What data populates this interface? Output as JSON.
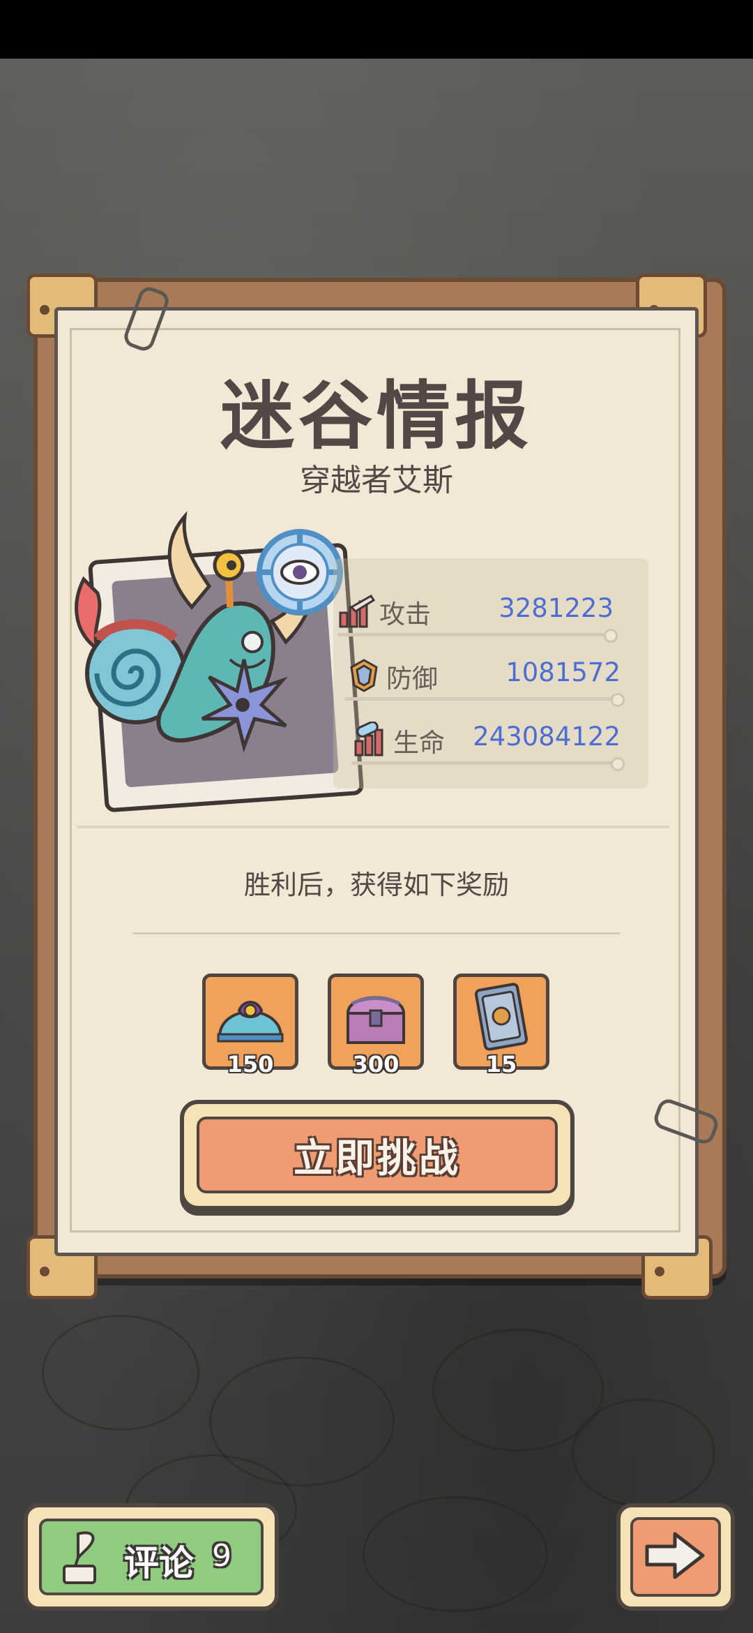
{
  "panel": {
    "title": "迷谷情报",
    "subtitle": "穿越者艾斯"
  },
  "stats": [
    {
      "icon": "attack-icon",
      "label": "攻击",
      "value": "3281223"
    },
    {
      "icon": "defense-icon",
      "label": "防御",
      "value": "1081572"
    },
    {
      "icon": "health-icon",
      "label": "生命",
      "value": "243084122"
    }
  ],
  "rewards": {
    "header": "胜利后，获得如下奖励",
    "items": [
      {
        "icon": "helmet-icon",
        "count": "150"
      },
      {
        "icon": "treasure-chest-icon",
        "count": "300"
      },
      {
        "icon": "card-icon",
        "count": "15"
      }
    ]
  },
  "challenge_button": {
    "label": "立即挑战"
  },
  "comment_button": {
    "label": "评论",
    "count": "9"
  },
  "next_button": {
    "icon": "arrow-right-icon"
  },
  "colors": {
    "stat_value": "#4b6ed0",
    "reward_bg": "#f0a25c",
    "challenge_bg": "#ef9c72",
    "comment_bg": "#8fcb80",
    "paper": "#f1e8d6"
  }
}
